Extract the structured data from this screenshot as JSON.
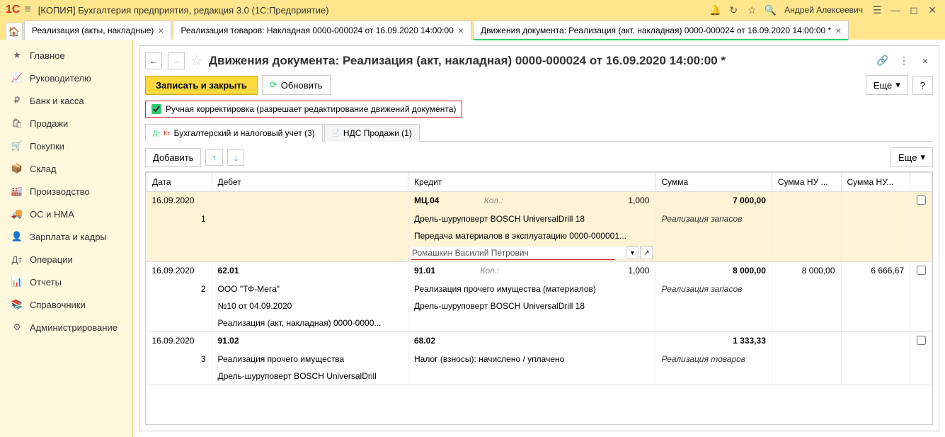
{
  "titlebar": {
    "title": "[КОПИЯ] Бухгалтерия предприятия, редакция 3.0  (1С:Предприятие)",
    "user": "Андрей Алексеевич"
  },
  "tabs": [
    {
      "label": "Реализация (акты, накладные)"
    },
    {
      "label": "Реализация товаров: Накладная 0000-000024 от 16.09.2020 14:00:00"
    },
    {
      "label": "Движения документа: Реализация (акт, накладная) 0000-000024 от 16.09.2020 14:00:00 *"
    }
  ],
  "sidebar": [
    "Главное",
    "Руководителю",
    "Банк и касса",
    "Продажи",
    "Покупки",
    "Склад",
    "Производство",
    "ОС и НМА",
    "Зарплата и кадры",
    "Операции",
    "Отчеты",
    "Справочники",
    "Администрирование"
  ],
  "page": {
    "title": "Движения документа: Реализация (акт, накладная) 0000-000024 от 16.09.2020 14:00:00 *",
    "save_close": "Записать и закрыть",
    "refresh": "Обновить",
    "more": "Еще",
    "help": "?",
    "manual_edit": "Ручная корректировка (разрешает редактирование движений документа)",
    "tab_acct": "Бухгалтерский и налоговый учет (3)",
    "tab_vat": "НДС Продажи (1)",
    "add": "Добавить",
    "cols": {
      "date": "Дата",
      "debit": "Дебет",
      "credit": "Кредит",
      "sum": "Сумма",
      "sum_nu1": "Сумма НУ ...",
      "sum_nu2": "Сумма НУ..."
    },
    "kol_label": "Кол.:"
  },
  "rows": [
    {
      "highlight": true,
      "date": "16.09.2020",
      "n": "1",
      "debit": "",
      "debit_sub": [],
      "credit": "МЦ.04",
      "qty": "1,000",
      "credit_sub": [
        "Дрель-шуруповерт BOSCH UniversalDrill 18",
        "Передача материалов в эксплуатацию 0000-000001..."
      ],
      "credit_input": "Ромашкин Василий Петрович",
      "sum": "7 000,00",
      "sum_label": "Реализация запасов",
      "sum_nu1": "",
      "sum_nu2": ""
    },
    {
      "date": "16.09.2020",
      "n": "2",
      "debit": "62.01",
      "debit_sub": [
        "ООО \"ТФ-Мега\"",
        "№10 от 04.09.2020",
        "Реализация (акт, накладная) 0000-0000..."
      ],
      "credit": "91.01",
      "qty": "1,000",
      "credit_sub": [
        "Реализация прочего имущества (материалов)",
        "Дрель-шуруповерт BOSCH UniversalDrill 18"
      ],
      "sum": "8 000,00",
      "sum_label": "Реализация запасов",
      "sum_nu1": "8 000,00",
      "sum_nu2": "6 666,67"
    },
    {
      "date": "16.09.2020",
      "n": "3",
      "debit": "91.02",
      "debit_sub": [
        "Реализация прочего имущества",
        "Дрель-шуруповерт BOSCH UniversalDrill"
      ],
      "credit": "68.02",
      "credit_sub": [
        "Налог (взносы): начислено / уплачено"
      ],
      "sum": "1 333,33",
      "sum_label": "Реализация товаров",
      "sum_nu1": "",
      "sum_nu2": ""
    }
  ]
}
